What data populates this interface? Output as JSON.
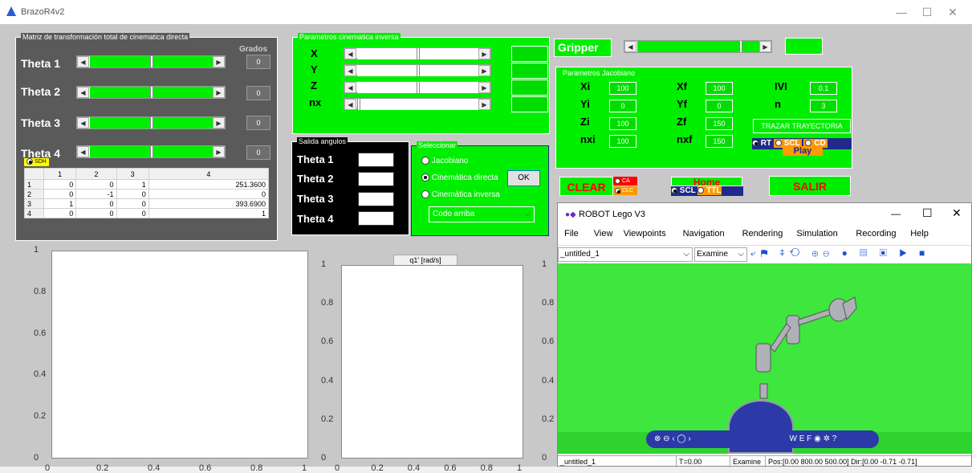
{
  "window": {
    "title": "BrazoR4v2",
    "min": "—",
    "max": "☐",
    "close": "✕"
  },
  "fk": {
    "title": "Matriz de transformación total de cinematica directa",
    "grados": "Grados",
    "thetas": [
      {
        "label": "Theta 1",
        "value": "0",
        "pos": 0.5
      },
      {
        "label": "Theta 2",
        "value": "0",
        "pos": 0.5
      },
      {
        "label": "Theta 3",
        "value": "0",
        "pos": 0.5
      },
      {
        "label": "Theta 4",
        "value": "0",
        "pos": 0.5
      }
    ],
    "sdh_label": "SDH",
    "table": {
      "cols": [
        "",
        "1",
        "2",
        "3",
        "4"
      ],
      "rows": [
        [
          "1",
          "0",
          "0",
          "1",
          "251.3600"
        ],
        [
          "2",
          "0",
          "-1",
          "0",
          "0"
        ],
        [
          "3",
          "1",
          "0",
          "0",
          "393.6900"
        ],
        [
          "4",
          "0",
          "0",
          "0",
          "1"
        ]
      ]
    }
  },
  "ik": {
    "title": "Parametros cinematica inversa",
    "rows": [
      {
        "label": "X",
        "pos": 0.5
      },
      {
        "label": "Y",
        "pos": 0.5
      },
      {
        "label": "Z",
        "pos": 0.5
      },
      {
        "label": "nx",
        "pos": 0
      }
    ]
  },
  "salida": {
    "title": "Salida angulos",
    "rows": [
      "Theta 1",
      "Theta 2",
      "Theta 3",
      "Theta 4"
    ]
  },
  "sel": {
    "title": "Seleccionar",
    "options": [
      "Jacobiano",
      "Cinemática directa",
      "Cinemática inversa"
    ],
    "selected": 1,
    "ok": "OK",
    "dropdown": "Codo arriba"
  },
  "gripper": {
    "label": "Gripper",
    "pos": 0.85
  },
  "jac": {
    "title": "Parametros Jacobiano",
    "c1": [
      {
        "label": "Xi",
        "value": "100"
      },
      {
        "label": "Yi",
        "value": "0"
      },
      {
        "label": "Zi",
        "value": "100"
      },
      {
        "label": "nxi",
        "value": "100"
      }
    ],
    "c2": [
      {
        "label": "Xf",
        "value": "100"
      },
      {
        "label": "Yf",
        "value": "0"
      },
      {
        "label": "Zf",
        "value": "150"
      },
      {
        "label": "nxf",
        "value": "150"
      }
    ],
    "c3": [
      {
        "label": "IVI",
        "value": "0.1"
      },
      {
        "label": "n",
        "value": "3"
      }
    ],
    "trazar": "TRAZAR TRAYECTORIA",
    "rt": "RT",
    "scl": "SCL",
    "cd": "CD",
    "play": "Play"
  },
  "buttons": {
    "clear": "CLEAR",
    "ca": "CA",
    "clc": "CLC",
    "home": "Home",
    "scl": "SCL",
    "ttl": "TTL",
    "salir": "SALIR"
  },
  "plot1": {
    "yticks": [
      "1",
      "0.8",
      "0.6",
      "0.4",
      "0.2",
      "0"
    ],
    "xticks": [
      "0",
      "0.2",
      "0.4",
      "0.6",
      "0.8",
      "1"
    ]
  },
  "plot2": {
    "title": "q1' [rad/s]",
    "yticks": [
      "1",
      "0.8",
      "0.6",
      "0.4",
      "0.2",
      "0"
    ],
    "xticks": [
      "0",
      "0.2",
      "0.4",
      "0.6",
      "0.8",
      "1"
    ]
  },
  "plot3": {
    "yticks": [
      "1",
      "0.8",
      "0.6",
      "0.4",
      "0.2",
      "0"
    ]
  },
  "robot": {
    "title": "ROBOT Lego V3",
    "menu": [
      "File",
      "View",
      "Viewpoints",
      "Navigation",
      "Rendering",
      "Simulation",
      "Recording",
      "Help"
    ],
    "world": "_untitled_1",
    "mode": "Examine",
    "status": [
      "_untitled_1",
      "T=0.00",
      "Examine",
      "Pos:[0.00 800.00 500.00] Dir:[0.00 -0.71 -0.71]"
    ]
  },
  "colors": {
    "green": "#00ee00",
    "dark": "#5a5a5a",
    "navy": "#1f2a8a",
    "red": "#ff0000",
    "orange": "#ff9900"
  }
}
